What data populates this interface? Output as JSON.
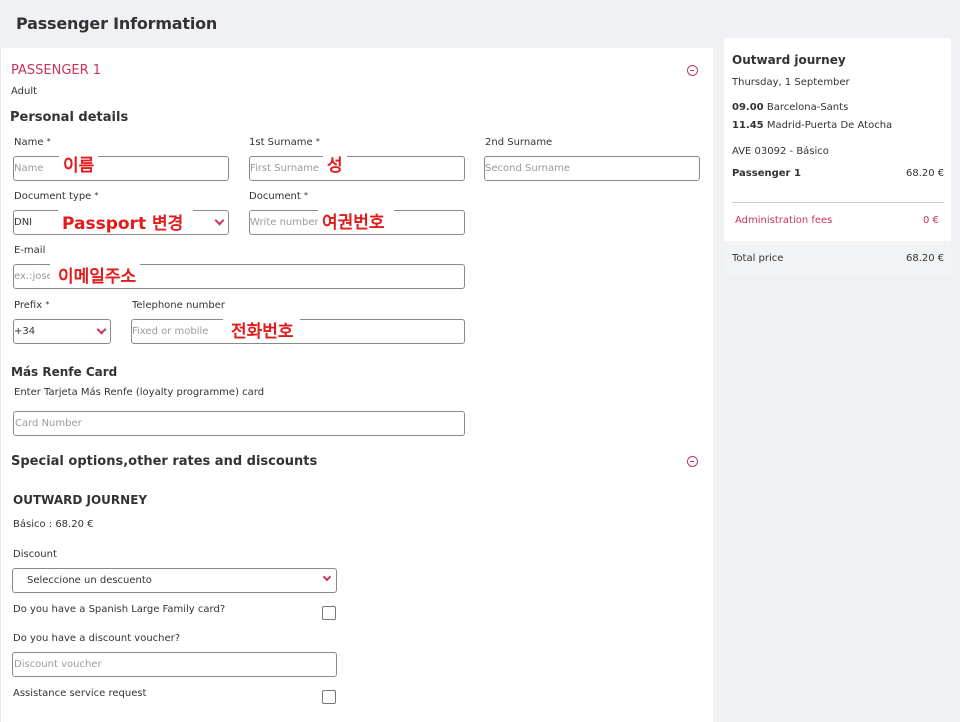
{
  "header": {
    "title": "Passenger Information"
  },
  "passenger": {
    "label": "PASSENGER 1",
    "type": "Adult",
    "personal_details": "Personal details",
    "name": {
      "label": "Name",
      "placeholder": "Name",
      "note": "이름"
    },
    "surname1": {
      "label": "1st Surname",
      "placeholder": "First Surname",
      "note": "성"
    },
    "surname2": {
      "label": "2nd Surname",
      "placeholder": "Second Surname"
    },
    "doc_type": {
      "label": "Document type",
      "value": "DNI",
      "note": "Passport 변경"
    },
    "document": {
      "label": "Document",
      "placeholder": "Write number",
      "note": "여권번호"
    },
    "email": {
      "label": "E-mail",
      "placeholder": "ex.:josel",
      "note": "이메일주소"
    },
    "prefix": {
      "label": "Prefix",
      "value": "+34"
    },
    "phone": {
      "label": "Telephone number",
      "placeholder": "Fixed or mobile",
      "note": "전화번호"
    },
    "required_mark": "*"
  },
  "mas_renfe": {
    "title": "Más Renfe Card",
    "description": "Enter Tarjeta Más Renfe (loyalty programme) card",
    "placeholder": "Card Number"
  },
  "special": {
    "title": "Special options,other rates and discounts",
    "outward": "OUTWARD JOURNEY",
    "fare": "Básico : 68.20 €",
    "discount_label": "Discount",
    "discount_value": "Seleccione un descuento",
    "large_family": "Do you have a Spanish Large Family card?",
    "voucher_q": "Do you have a discount voucher?",
    "voucher_placeholder": "Discount voucher",
    "assistance": "Assistance service request"
  },
  "summary": {
    "title": "Outward journey",
    "date": "Thursday, 1 September",
    "dep_time": "09.00",
    "dep_station": "Barcelona-Sants",
    "arr_time": "11.45",
    "arr_station": "Madrid-Puerta De Atocha",
    "train": "AVE 03092 - Básico",
    "passenger_label": "Passenger 1",
    "passenger_price": "68.20 €",
    "fees_label": "Administration fees",
    "fees_value": "0 €",
    "total_label": "Total price",
    "total_value": "68.20 €"
  },
  "colors": {
    "accent": "#c8345c",
    "annotation": "#e21b1b",
    "panel_bg": "#eff1f4"
  }
}
